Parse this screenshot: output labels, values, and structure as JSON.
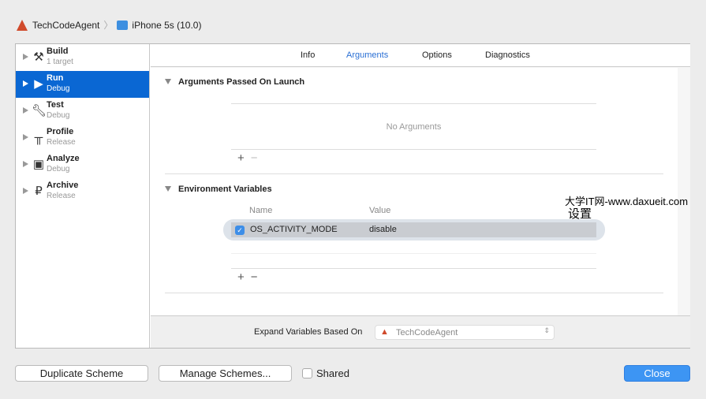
{
  "breadcrumb": {
    "project": "TechCodeAgent",
    "device": "iPhone 5s (10.0)"
  },
  "sidebar": {
    "items": [
      {
        "title": "Build",
        "subtitle": "1 target",
        "icon": "hammer-icon"
      },
      {
        "title": "Run",
        "subtitle": "Debug",
        "icon": "play-icon",
        "selected": true
      },
      {
        "title": "Test",
        "subtitle": "Debug",
        "icon": "wrench-icon"
      },
      {
        "title": "Profile",
        "subtitle": "Release",
        "icon": "gauge-icon"
      },
      {
        "title": "Analyze",
        "subtitle": "Debug",
        "icon": "analyze-icon"
      },
      {
        "title": "Archive",
        "subtitle": "Release",
        "icon": "archive-icon"
      }
    ]
  },
  "tabs": [
    "Info",
    "Arguments",
    "Options",
    "Diagnostics"
  ],
  "active_tab": "Arguments",
  "arguments": {
    "title": "Arguments Passed On Launch",
    "empty": "No Arguments"
  },
  "env": {
    "title": "Environment Variables",
    "col_name": "Name",
    "col_value": "Value",
    "rows": [
      {
        "checked": true,
        "name": "OS_ACTIVITY_MODE",
        "value": "disable"
      }
    ]
  },
  "add_label": "+",
  "remove_label": "−",
  "expand": {
    "label": "Expand Variables Based On",
    "value": "TechCodeAgent"
  },
  "watermark": {
    "line1": "大学IT网-www.daxueit.com",
    "line2": "设置"
  },
  "buttons": {
    "duplicate": "Duplicate Scheme",
    "manage": "Manage Schemes...",
    "shared": "Shared",
    "close": "Close"
  },
  "colors": {
    "accent": "#0a67d3",
    "close": "#3d95f3"
  }
}
